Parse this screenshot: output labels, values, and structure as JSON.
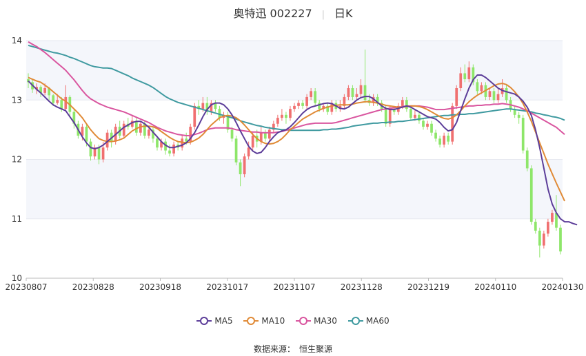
{
  "title": {
    "name": "奥特迅 002227",
    "period": "日K"
  },
  "source": {
    "label": "数据来源：",
    "value": "恒生聚源"
  },
  "colors": {
    "up": "#f07070",
    "down": "#8ee66a",
    "ma5": "#5c3d99",
    "ma10": "#e08a36",
    "ma30": "#d9559f",
    "ma60": "#3f9aa0",
    "band": "#f4f6fb"
  },
  "chart_data": {
    "type": "candlestick",
    "ylim": [
      10,
      14
    ],
    "y_ticks": [
      "10",
      "11",
      "12",
      "13",
      "14"
    ],
    "x_ticks": [
      "20230807",
      "20230828",
      "20230918",
      "20231017",
      "20231107",
      "20231128",
      "20231219",
      "20240110",
      "20240130"
    ],
    "legend": [
      "MA5",
      "MA10",
      "MA30",
      "MA60"
    ],
    "ma": {
      "MA5": [
        13.32,
        13.25,
        13.18,
        13.12,
        13.05,
        12.98,
        12.92,
        12.88,
        12.85,
        12.82,
        12.72,
        12.62,
        12.5,
        12.38,
        12.28,
        12.2,
        12.18,
        12.2,
        12.24,
        12.3,
        12.36,
        12.42,
        12.48,
        12.54,
        12.58,
        12.62,
        12.64,
        12.64,
        12.6,
        12.54,
        12.46,
        12.38,
        12.3,
        12.24,
        12.2,
        12.2,
        12.22,
        12.24,
        12.28,
        12.35,
        12.45,
        12.58,
        12.72,
        12.84,
        12.92,
        12.95,
        12.95,
        12.92,
        12.85,
        12.75,
        12.62,
        12.48,
        12.35,
        12.22,
        12.14,
        12.1,
        12.12,
        12.2,
        12.3,
        12.38,
        12.45,
        12.48,
        12.5,
        12.55,
        12.62,
        12.7,
        12.78,
        12.84,
        12.88,
        12.9,
        12.92,
        12.94,
        12.95,
        12.94,
        12.9,
        12.86,
        12.85,
        12.88,
        12.94,
        13.0,
        13.04,
        13.06,
        13.06,
        13.02,
        12.96,
        12.9,
        12.86,
        12.84,
        12.84,
        12.86,
        12.88,
        12.9,
        12.88,
        12.84,
        12.8,
        12.76,
        12.72,
        12.7,
        12.68,
        12.62,
        12.54,
        12.48,
        12.5,
        12.62,
        12.82,
        13.02,
        13.2,
        13.34,
        13.42,
        13.42,
        13.38,
        13.32,
        13.26,
        13.2,
        13.16,
        13.14,
        13.12,
        13.1,
        13.05,
        12.98,
        12.88,
        12.74,
        12.5,
        12.2,
        11.85,
        11.5,
        11.25,
        11.1,
        11.0,
        10.95,
        10.95,
        10.92,
        10.9
      ],
      "MA10": [
        13.38,
        13.35,
        13.32,
        13.3,
        13.25,
        13.2,
        13.14,
        13.08,
        13.02,
        12.98,
        12.92,
        12.85,
        12.78,
        12.7,
        12.6,
        12.5,
        12.42,
        12.35,
        12.32,
        12.3,
        12.3,
        12.31,
        12.33,
        12.36,
        12.42,
        12.48,
        12.52,
        12.55,
        12.56,
        12.56,
        12.55,
        12.52,
        12.47,
        12.42,
        12.37,
        12.33,
        12.3,
        12.29,
        12.28,
        12.29,
        12.32,
        12.36,
        12.42,
        12.5,
        12.58,
        12.64,
        12.7,
        12.73,
        12.74,
        12.73,
        12.7,
        12.65,
        12.58,
        12.5,
        12.42,
        12.35,
        12.3,
        12.27,
        12.26,
        12.27,
        12.3,
        12.35,
        12.42,
        12.5,
        12.56,
        12.62,
        12.68,
        12.72,
        12.76,
        12.8,
        12.83,
        12.86,
        12.88,
        12.9,
        12.91,
        12.92,
        12.92,
        12.92,
        12.93,
        12.95,
        12.96,
        12.97,
        12.97,
        12.96,
        12.95,
        12.93,
        12.91,
        12.9,
        12.89,
        12.88,
        12.88,
        12.89,
        12.9,
        12.9,
        12.89,
        12.87,
        12.84,
        12.8,
        12.76,
        12.72,
        12.69,
        12.68,
        12.7,
        12.75,
        12.82,
        12.9,
        12.97,
        13.03,
        13.08,
        13.12,
        13.16,
        13.2,
        13.24,
        13.27,
        13.28,
        13.26,
        13.21,
        13.14,
        13.05,
        12.94,
        12.8,
        12.64,
        12.46,
        12.28,
        12.1,
        11.92,
        11.76,
        11.6,
        11.45,
        11.3
      ],
      "MA30": [
        13.98,
        13.94,
        13.9,
        13.85,
        13.8,
        13.74,
        13.68,
        13.62,
        13.56,
        13.5,
        13.42,
        13.34,
        13.25,
        13.16,
        13.08,
        13.02,
        12.98,
        12.94,
        12.91,
        12.88,
        12.86,
        12.84,
        12.82,
        12.8,
        12.77,
        12.74,
        12.71,
        12.68,
        12.65,
        12.62,
        12.58,
        12.54,
        12.51,
        12.48,
        12.46,
        12.44,
        12.42,
        12.41,
        12.4,
        12.4,
        12.42,
        12.44,
        12.47,
        12.5,
        12.52,
        12.53,
        12.53,
        12.53,
        12.53,
        12.52,
        12.5,
        12.49,
        12.48,
        12.47,
        12.46,
        12.46,
        12.45,
        12.45,
        12.45,
        12.45,
        12.46,
        12.47,
        12.49,
        12.51,
        12.53,
        12.55,
        12.57,
        12.59,
        12.6,
        12.61,
        12.61,
        12.61,
        12.61,
        12.61,
        12.62,
        12.64,
        12.66,
        12.68,
        12.7,
        12.72,
        12.74,
        12.76,
        12.78,
        12.8,
        12.82,
        12.84,
        12.85,
        12.86,
        12.87,
        12.88,
        12.89,
        12.9,
        12.9,
        12.9,
        12.9,
        12.89,
        12.88,
        12.86,
        12.84,
        12.84,
        12.84,
        12.85,
        12.86,
        12.87,
        12.88,
        12.89,
        12.9,
        12.9,
        12.91,
        12.91,
        12.92,
        12.92,
        12.93,
        12.93,
        12.94,
        12.93,
        12.92,
        12.9,
        12.88,
        12.85,
        12.82,
        12.78,
        12.74,
        12.7,
        12.66,
        12.62,
        12.58,
        12.54,
        12.48,
        12.42
      ],
      "MA60": [
        13.92,
        13.9,
        13.88,
        13.86,
        13.84,
        13.82,
        13.8,
        13.79,
        13.77,
        13.75,
        13.72,
        13.7,
        13.67,
        13.64,
        13.61,
        13.58,
        13.56,
        13.55,
        13.54,
        13.54,
        13.53,
        13.5,
        13.47,
        13.44,
        13.41,
        13.37,
        13.34,
        13.31,
        13.28,
        13.25,
        13.21,
        13.16,
        13.11,
        13.06,
        13.02,
        12.99,
        12.96,
        12.94,
        12.92,
        12.9,
        12.88,
        12.86,
        12.84,
        12.82,
        12.8,
        12.78,
        12.76,
        12.74,
        12.72,
        12.7,
        12.68,
        12.65,
        12.63,
        12.61,
        12.59,
        12.57,
        12.56,
        12.54,
        12.53,
        12.52,
        12.51,
        12.5,
        12.5,
        12.49,
        12.49,
        12.49,
        12.49,
        12.49,
        12.49,
        12.49,
        12.49,
        12.5,
        12.5,
        12.51,
        12.51,
        12.52,
        12.53,
        12.54,
        12.56,
        12.57,
        12.58,
        12.59,
        12.6,
        12.61,
        12.61,
        12.62,
        12.62,
        12.63,
        12.63,
        12.64,
        12.64,
        12.65,
        12.66,
        12.67,
        12.68,
        12.69,
        12.7,
        12.71,
        12.72,
        12.73,
        12.74,
        12.74,
        12.75,
        12.75,
        12.76,
        12.76,
        12.77,
        12.77,
        12.78,
        12.79,
        12.8,
        12.81,
        12.82,
        12.83,
        12.84,
        12.85,
        12.85,
        12.84,
        12.83,
        12.82,
        12.81,
        12.8,
        12.78,
        12.77,
        12.75,
        12.74,
        12.72,
        12.71,
        12.69,
        12.66
      ]
    },
    "candles": [
      [
        13.35,
        13.3,
        13.45,
        13.2
      ],
      [
        13.3,
        13.18,
        13.35,
        13.12
      ],
      [
        13.18,
        13.22,
        13.28,
        13.1
      ],
      [
        13.22,
        13.12,
        13.25,
        13.05
      ],
      [
        13.12,
        13.2,
        13.28,
        13.08
      ],
      [
        13.2,
        13.08,
        13.22,
        13.0
      ],
      [
        13.08,
        12.95,
        13.1,
        12.9
      ],
      [
        12.95,
        13.0,
        13.1,
        12.92
      ],
      [
        13.0,
        12.85,
        13.05,
        12.8
      ],
      [
        12.85,
        13.05,
        13.25,
        12.8
      ],
      [
        13.05,
        12.8,
        13.08,
        12.72
      ],
      [
        12.8,
        12.6,
        12.85,
        12.52
      ],
      [
        12.6,
        12.4,
        12.65,
        12.35
      ],
      [
        12.4,
        12.55,
        12.6,
        12.32
      ],
      [
        12.55,
        12.3,
        12.6,
        12.22
      ],
      [
        12.3,
        12.05,
        12.35,
        11.98
      ],
      [
        12.05,
        12.2,
        12.25,
        12.0
      ],
      [
        12.2,
        12.0,
        12.25,
        11.92
      ],
      [
        12.0,
        12.2,
        12.3,
        11.95
      ],
      [
        12.2,
        12.45,
        12.5,
        12.15
      ],
      [
        12.45,
        12.3,
        12.5,
        12.2
      ],
      [
        12.3,
        12.55,
        12.6,
        12.25
      ],
      [
        12.55,
        12.4,
        12.65,
        12.35
      ],
      [
        12.4,
        12.6,
        12.65,
        12.35
      ],
      [
        12.6,
        12.55,
        12.7,
        12.5
      ],
      [
        12.55,
        12.65,
        12.75,
        12.52
      ],
      [
        12.65,
        12.45,
        12.7,
        12.4
      ],
      [
        12.45,
        12.6,
        12.65,
        12.4
      ],
      [
        12.6,
        12.4,
        12.65,
        12.35
      ],
      [
        12.4,
        12.5,
        12.55,
        12.35
      ],
      [
        12.5,
        12.35,
        12.55,
        12.28
      ],
      [
        12.35,
        12.2,
        12.4,
        12.15
      ],
      [
        12.2,
        12.3,
        12.35,
        12.15
      ],
      [
        12.3,
        12.15,
        12.35,
        12.08
      ],
      [
        12.15,
        12.1,
        12.25,
        12.05
      ],
      [
        12.1,
        12.25,
        12.3,
        12.05
      ],
      [
        12.25,
        12.2,
        12.3,
        12.15
      ],
      [
        12.2,
        12.35,
        12.4,
        12.15
      ],
      [
        12.35,
        12.3,
        12.45,
        12.25
      ],
      [
        12.3,
        12.55,
        12.6,
        12.25
      ],
      [
        12.55,
        12.9,
        12.95,
        12.5
      ],
      [
        12.9,
        12.85,
        13.0,
        12.75
      ],
      [
        12.85,
        12.95,
        13.05,
        12.8
      ],
      [
        12.95,
        12.8,
        13.05,
        12.75
      ],
      [
        12.8,
        12.95,
        13.0,
        12.75
      ],
      [
        12.95,
        12.85,
        13.0,
        12.8
      ],
      [
        12.85,
        12.7,
        12.9,
        12.65
      ],
      [
        12.7,
        12.75,
        12.8,
        12.6
      ],
      [
        12.75,
        12.5,
        12.8,
        12.45
      ],
      [
        12.5,
        12.35,
        12.55,
        12.3
      ],
      [
        12.35,
        11.95,
        12.4,
        11.9
      ],
      [
        11.95,
        11.75,
        12.0,
        11.55
      ],
      [
        11.75,
        12.05,
        12.1,
        11.7
      ],
      [
        12.05,
        12.2,
        12.3,
        12.0
      ],
      [
        12.2,
        12.4,
        12.45,
        12.15
      ],
      [
        12.4,
        12.3,
        12.5,
        12.2
      ],
      [
        12.3,
        12.45,
        12.55,
        12.25
      ],
      [
        12.45,
        12.35,
        12.5,
        12.3
      ],
      [
        12.35,
        12.5,
        12.55,
        12.3
      ],
      [
        12.5,
        12.6,
        12.65,
        12.45
      ],
      [
        12.6,
        12.7,
        12.75,
        12.55
      ],
      [
        12.7,
        12.75,
        12.85,
        12.65
      ],
      [
        12.75,
        12.7,
        12.8,
        12.6
      ],
      [
        12.7,
        12.85,
        12.9,
        12.65
      ],
      [
        12.85,
        12.9,
        12.95,
        12.8
      ],
      [
        12.9,
        12.95,
        13.0,
        12.85
      ],
      [
        12.95,
        12.9,
        13.0,
        12.85
      ],
      [
        12.9,
        13.05,
        13.1,
        12.85
      ],
      [
        13.05,
        13.15,
        13.2,
        13.0
      ],
      [
        13.15,
        12.95,
        13.2,
        12.9
      ],
      [
        12.95,
        12.85,
        13.0,
        12.8
      ],
      [
        12.85,
        12.9,
        12.95,
        12.8
      ],
      [
        12.9,
        12.8,
        12.95,
        12.75
      ],
      [
        12.8,
        12.95,
        13.0,
        12.75
      ],
      [
        12.95,
        12.85,
        13.0,
        12.8
      ],
      [
        12.85,
        12.9,
        13.0,
        12.8
      ],
      [
        12.9,
        13.05,
        13.1,
        12.85
      ],
      [
        13.05,
        13.2,
        13.25,
        13.0
      ],
      [
        13.2,
        13.05,
        13.25,
        13.0
      ],
      [
        13.05,
        13.1,
        13.2,
        13.0
      ],
      [
        13.1,
        13.25,
        13.35,
        13.05
      ],
      [
        13.25,
        13.0,
        13.85,
        12.95
      ],
      [
        13.0,
        12.95,
        13.1,
        12.9
      ],
      [
        12.95,
        13.05,
        13.1,
        12.9
      ],
      [
        13.05,
        12.95,
        13.1,
        12.9
      ],
      [
        12.95,
        12.85,
        13.0,
        12.8
      ],
      [
        12.85,
        12.6,
        12.9,
        12.55
      ],
      [
        12.6,
        12.85,
        12.9,
        12.55
      ],
      [
        12.85,
        12.8,
        12.9,
        12.75
      ],
      [
        12.8,
        12.9,
        12.95,
        12.75
      ],
      [
        12.9,
        13.0,
        13.05,
        12.85
      ],
      [
        13.0,
        12.85,
        13.05,
        12.8
      ],
      [
        12.85,
        12.7,
        12.9,
        12.65
      ],
      [
        12.7,
        12.75,
        12.85,
        12.65
      ],
      [
        12.75,
        12.65,
        12.8,
        12.6
      ],
      [
        12.65,
        12.55,
        12.7,
        12.5
      ],
      [
        12.55,
        12.6,
        12.65,
        12.5
      ],
      [
        12.6,
        12.45,
        12.65,
        12.4
      ],
      [
        12.45,
        12.35,
        12.5,
        12.3
      ],
      [
        12.35,
        12.25,
        12.4,
        12.2
      ],
      [
        12.25,
        12.4,
        12.45,
        12.2
      ],
      [
        12.4,
        12.3,
        12.45,
        12.25
      ],
      [
        12.3,
        12.9,
        12.95,
        12.25
      ],
      [
        12.9,
        13.2,
        13.25,
        12.85
      ],
      [
        13.2,
        13.45,
        13.55,
        13.15
      ],
      [
        13.45,
        13.35,
        13.6,
        13.3
      ],
      [
        13.35,
        13.55,
        13.65,
        13.3
      ],
      [
        13.55,
        13.3,
        13.6,
        13.25
      ],
      [
        13.3,
        13.15,
        13.35,
        13.1
      ],
      [
        13.15,
        13.25,
        13.3,
        13.1
      ],
      [
        13.25,
        13.05,
        13.3,
        13.0
      ],
      [
        13.05,
        13.15,
        13.2,
        13.0
      ],
      [
        13.15,
        13.0,
        13.2,
        12.95
      ],
      [
        13.0,
        13.1,
        13.2,
        12.95
      ],
      [
        13.1,
        13.2,
        13.35,
        13.05
      ],
      [
        13.2,
        13.0,
        13.25,
        12.95
      ],
      [
        13.0,
        12.85,
        13.05,
        12.8
      ],
      [
        12.85,
        12.75,
        12.9,
        12.7
      ],
      [
        12.75,
        12.7,
        12.8,
        12.6
      ],
      [
        12.7,
        12.15,
        12.75,
        12.1
      ],
      [
        12.15,
        11.85,
        12.2,
        11.8
      ],
      [
        11.85,
        10.95,
        11.9,
        10.9
      ],
      [
        10.95,
        10.8,
        11.0,
        10.75
      ],
      [
        10.8,
        10.55,
        10.85,
        10.35
      ],
      [
        10.55,
        10.75,
        10.8,
        10.5
      ],
      [
        10.75,
        10.95,
        11.0,
        10.7
      ],
      [
        10.95,
        11.1,
        11.15,
        10.9
      ],
      [
        11.1,
        10.85,
        11.4,
        10.8
      ],
      [
        10.85,
        10.45,
        10.9,
        10.4
      ]
    ]
  }
}
